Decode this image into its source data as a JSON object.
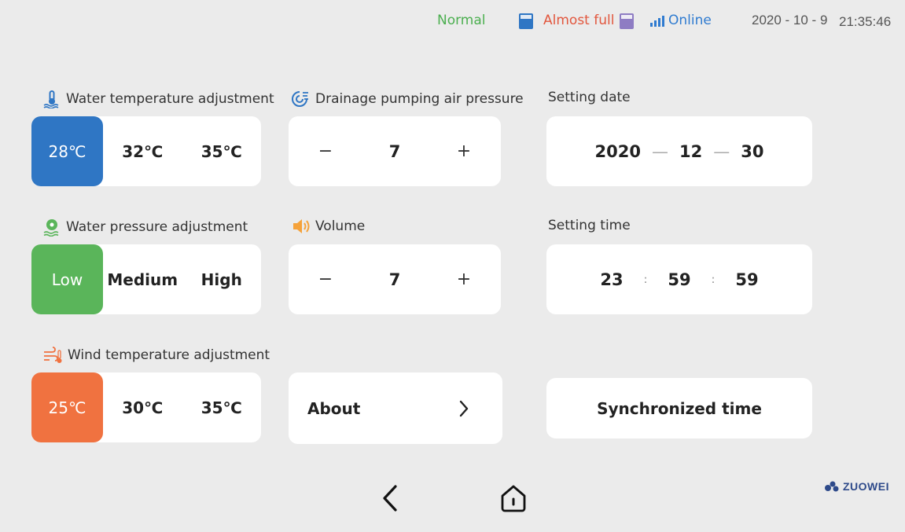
{
  "status": {
    "mode": "Normal",
    "bucket": "Almost full",
    "network": "Online",
    "date": "2020 - 10 - 9",
    "time": "21:35:46"
  },
  "water_temp": {
    "title": "Water temperature adjustment",
    "options": [
      "28℃",
      "32℃",
      "35℃"
    ],
    "selected": "28℃"
  },
  "drainage": {
    "title": "Drainage pumping air pressure",
    "value": "7",
    "minus": "−",
    "plus": "+"
  },
  "setting_date": {
    "title": "Setting date",
    "year": "2020",
    "month": "12",
    "day": "30",
    "separator": "—"
  },
  "water_pressure": {
    "title": "Water pressure adjustment",
    "options": [
      "Low",
      "Medium",
      "High"
    ],
    "selected": "Low"
  },
  "volume": {
    "title": "Volume",
    "value": "7",
    "minus": "−",
    "plus": "+"
  },
  "setting_time": {
    "title": "Setting time",
    "hour": "23",
    "minute": "59",
    "second": "59",
    "separator": ":"
  },
  "wind_temp": {
    "title": "Wind temperature adjustment",
    "options": [
      "25℃",
      "30℃",
      "35℃"
    ],
    "selected": "25℃"
  },
  "about": {
    "label": "About",
    "chevron": "›"
  },
  "sync": {
    "label": "Synchronized time"
  },
  "brand": {
    "name": "ZUOWEI"
  },
  "icons": {
    "water_temp": "water-thermometer-icon",
    "drainage": "swirl-pump-icon",
    "water_pressure": "water-pressure-icon",
    "volume": "speaker-icon",
    "wind_temp": "wind-thermometer-icon",
    "back": "chevron-left-icon",
    "home": "home-icon"
  },
  "colors": {
    "blue": "#2f76c4",
    "green": "#5ab55a",
    "orange": "#f07240",
    "normal": "#4caf50",
    "almost_full": "#e2573e",
    "online": "#2f7bd0"
  }
}
